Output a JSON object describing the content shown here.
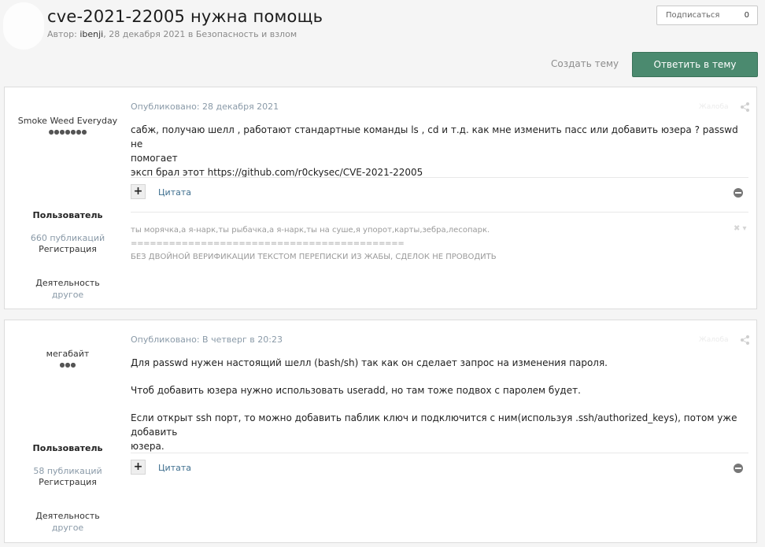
{
  "topic": {
    "title": "cve-2021-22005 нужна помощь",
    "author_prefix": "Автор: ",
    "author": "ibenji",
    "date_suffix": ", 28 декабря 2021 в ",
    "forum": "Безопасность и взлом"
  },
  "actions": {
    "subscribe_label": "Подписаться",
    "subscribe_count": "0",
    "create_topic": "Создать тему",
    "reply": "Ответить в тему"
  },
  "posts": [
    {
      "author": "Smoke Weed Everyday",
      "rep_dots": "●●●●●●●",
      "group": "Пользователь",
      "posts_count": "660 публикаций",
      "reg_label": "Регистрация",
      "activity_label": "Деятельность",
      "activity_value": "другое",
      "posted": "Опубликовано: 28 декабря 2021",
      "report": "Жалоба",
      "lines": [
        "сабж, получаю шелл , работают стандартные команды ls , cd  и т.д.  как мне изменить пасс или добавить юзера ?  passwd не",
        "помогает",
        "эксп брал этот https://github.com/r0ckysec/CVE-2021-22005"
      ],
      "quote": "Цитата",
      "signature": [
        "ты морячка,а я-нарк,ты рыбачка,а я-нарк,ты на суше,я упорот,карты,зебра,лесопарк.",
        "===========================================",
        "БЕЗ ДВОЙНОЙ ВЕРИФИКАЦИИ ТЕКСТОМ ПЕРЕПИСКИ ИЗ ЖАБЫ, СДЕЛОК НЕ ПРОВОДИТЬ"
      ]
    },
    {
      "author": "мегабайт",
      "rep_dots": "●●●",
      "group": "Пользователь",
      "posts_count": "58 публикаций",
      "reg_label": "Регистрация",
      "activity_label": "Деятельность",
      "activity_value": "другое",
      "posted": "Опубликовано: В четверг в 20:23",
      "report": "Жалоба",
      "lines": [
        "Для passwd нужен настоящий шелл (bash/sh) так как он сделает запрос на изменения пароля.",
        "Чтоб добавить юзера нужно использовать useradd, но там тоже подвох с паролем будет.",
        "Если открыт ssh порт, то можно добавить паблик ключ и подключится с ним(используя .ssh/authorized_keys), потом уже добавить",
        "юзера."
      ],
      "quote": "Цитата"
    }
  ]
}
